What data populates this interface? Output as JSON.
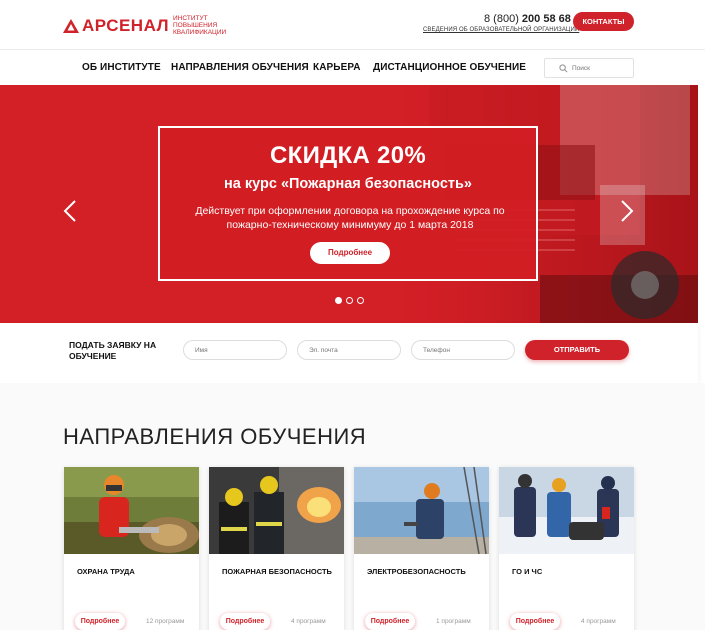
{
  "header": {
    "logo_text": "АРСЕНАЛ",
    "logo_subtitle": "ИНСТИТУТ ПОВЫШЕНИЯ КВАЛИФИКАЦИИ",
    "phone_prefix": "8 (800)",
    "phone_number": "200 58 68",
    "org_link": "СВЕДЕНИЯ ОБ ОБРАЗОВАТЕЛЬНОЙ ОРГАНИЗАЦИИ",
    "contacts_label": "КОНТАКТЫ",
    "brand_color": "#d0222a"
  },
  "nav": {
    "items": [
      {
        "label": "ОБ ИНСТИТУТЕ"
      },
      {
        "label": "НАПРАВЛЕНИЯ ОБУЧЕНИЯ"
      },
      {
        "label": "КАРЬЕРА"
      },
      {
        "label": "ДИСТАНЦИОННОЕ ОБУЧЕНИЕ"
      }
    ],
    "search_placeholder": "Поиск"
  },
  "hero": {
    "title": "СКИДКА 20%",
    "subtitle": "на курс «Пожарная безопасность»",
    "description": "Действует при оформлении договора на прохождение курса по пожарно-техническому минимуму до 1 марта 2018",
    "button_label": "Подробнее",
    "slides_total": 3,
    "active_slide": 1
  },
  "request_form": {
    "label": "ПОДАТЬ ЗАЯВКУ НА ОБУЧЕНИЕ",
    "name_placeholder": "Имя",
    "email_placeholder": "Эл. почта",
    "phone_placeholder": "Телефон",
    "submit_label": "ОТПРАВИТЬ"
  },
  "directions": {
    "title": "НАПРАВЛЕНИЯ ОБУЧЕНИЯ",
    "cards": [
      {
        "title": "ОХРАНА ТРУДА",
        "button": "Подробнее",
        "count": "12 программ"
      },
      {
        "title": "ПОЖАРНАЯ БЕЗОПАСНОСТЬ",
        "button": "Подробнее",
        "count": "4 программ"
      },
      {
        "title": "ЭЛЕКТРОБЕЗОПАСНОСТЬ",
        "button": "Подробнее",
        "count": "1 программ"
      },
      {
        "title": "ГО И ЧС",
        "button": "Подробнее",
        "count": "4 программ"
      }
    ]
  }
}
